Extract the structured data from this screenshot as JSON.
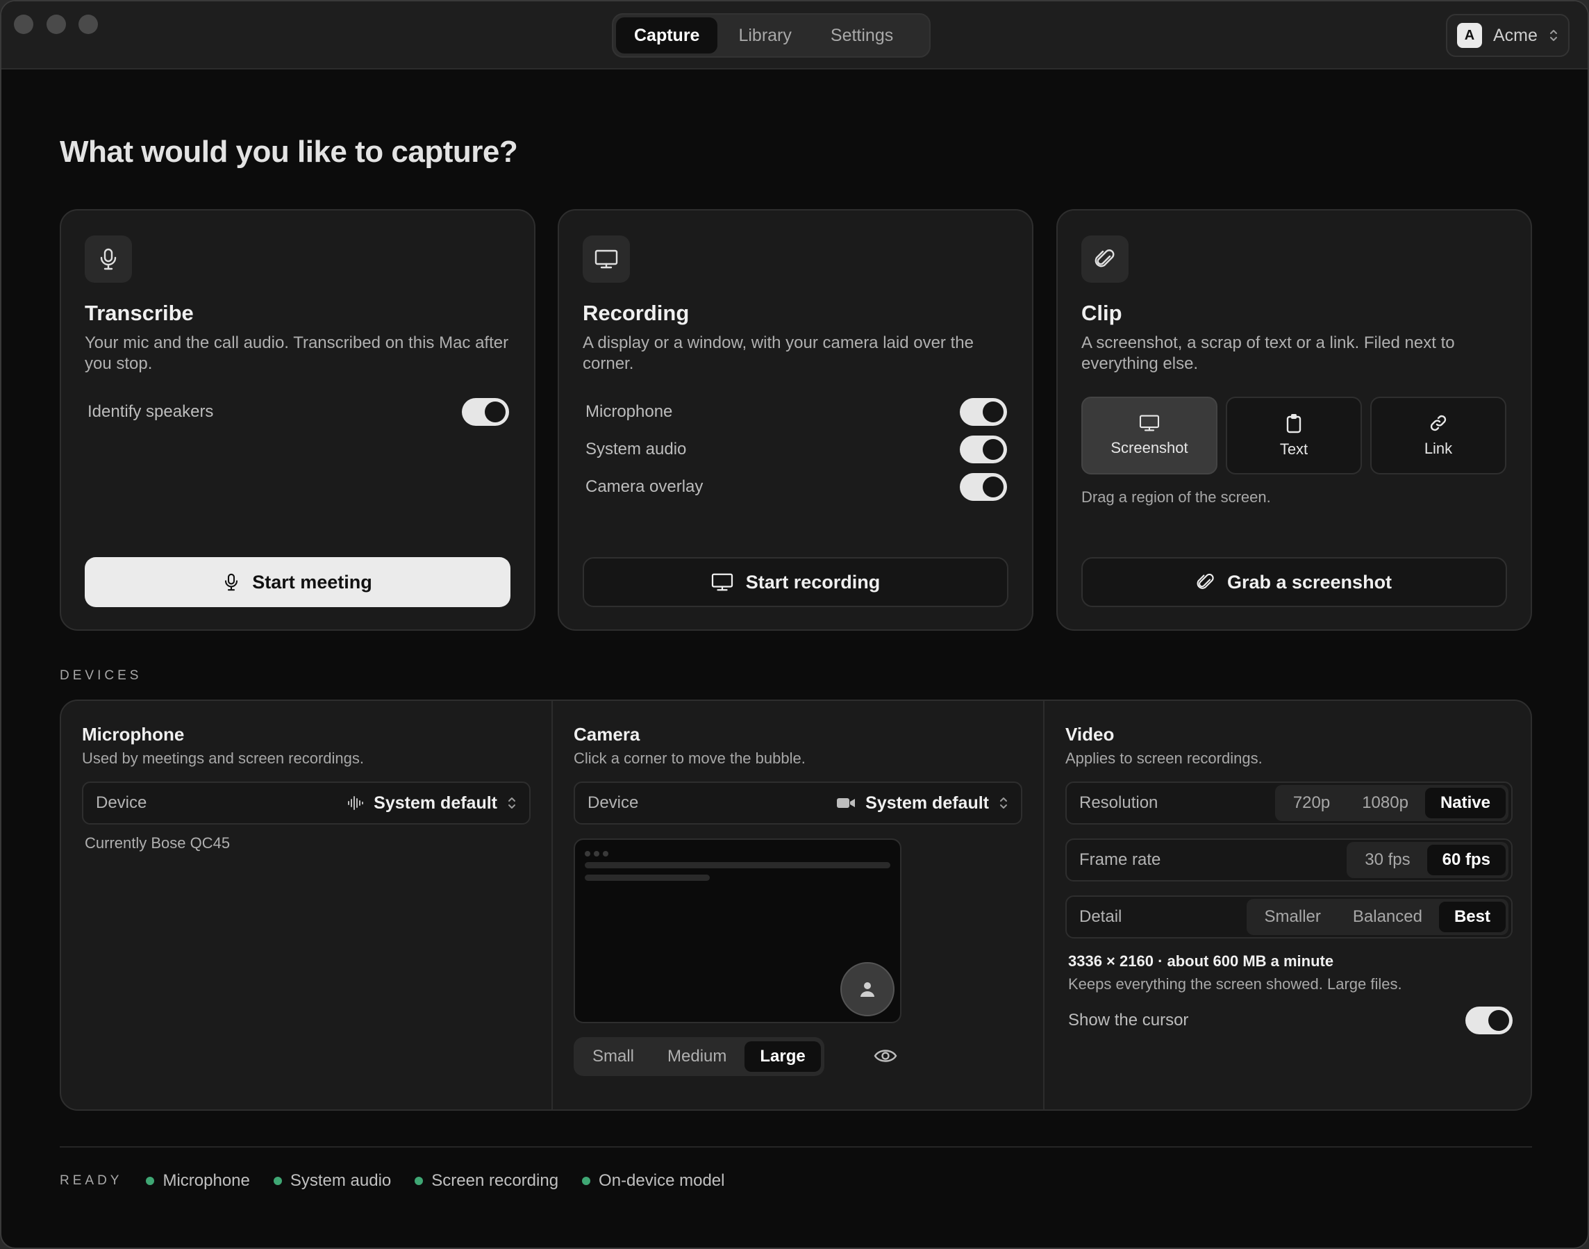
{
  "header": {
    "tabs": [
      {
        "label": "Capture",
        "active": true
      },
      {
        "label": "Library",
        "active": false
      },
      {
        "label": "Settings",
        "active": false
      }
    ],
    "account": {
      "initial": "A",
      "name": "Acme"
    }
  },
  "page_title": "What would you like to capture?",
  "cards": {
    "transcribe": {
      "icon": "microphone-icon",
      "title": "Transcribe",
      "description": "Your mic and the call audio. Transcribed on this Mac after you stop.",
      "options": [
        {
          "label": "Identify speakers",
          "on": true
        }
      ],
      "action": "Start meeting"
    },
    "recording": {
      "icon": "display-icon",
      "title": "Recording",
      "description": "A display or a window, with your camera laid over the corner.",
      "options": [
        {
          "label": "Microphone",
          "on": true
        },
        {
          "label": "System audio",
          "on": true
        },
        {
          "label": "Camera overlay",
          "on": true
        }
      ],
      "action": "Start recording"
    },
    "clip": {
      "icon": "paperclip-icon",
      "title": "Clip",
      "description": "A screenshot, a scrap of text or a link. Filed next to everything else.",
      "modes": [
        {
          "label": "Screenshot",
          "icon": "display-icon",
          "active": true
        },
        {
          "label": "Text",
          "icon": "clipboard-icon",
          "active": false
        },
        {
          "label": "Link",
          "icon": "link-icon",
          "active": false
        }
      ],
      "hint": "Drag a region of the screen.",
      "action": "Grab a screenshot"
    }
  },
  "devices": {
    "section_label": "DEVICES",
    "microphone": {
      "title": "Microphone",
      "subtitle": "Used by meetings and screen recordings.",
      "field_label": "Device",
      "field_value": "System default",
      "note": "Currently Bose QC45"
    },
    "camera": {
      "title": "Camera",
      "subtitle": "Click a corner to move the bubble.",
      "field_label": "Device",
      "field_value": "System default",
      "sizes": [
        {
          "label": "Small",
          "active": false
        },
        {
          "label": "Medium",
          "active": false
        },
        {
          "label": "Large",
          "active": true
        }
      ]
    },
    "video": {
      "title": "Video",
      "subtitle": "Applies to screen recordings.",
      "rows": [
        {
          "label": "Resolution",
          "options": [
            "720p",
            "1080p",
            "Native"
          ],
          "selected": 2
        },
        {
          "label": "Frame rate",
          "options": [
            "30 fps",
            "60 fps"
          ],
          "selected": 1
        },
        {
          "label": "Detail",
          "options": [
            "Smaller",
            "Balanced",
            "Best"
          ],
          "selected": 2
        }
      ],
      "info": "3336 × 2160 · about 600 MB a minute",
      "info_detail": "Keeps everything the screen showed. Large files.",
      "cursor_label": "Show the cursor",
      "cursor_on": true
    }
  },
  "footer": {
    "label": "READY",
    "status_color": "#3fa774",
    "items": [
      "Microphone",
      "System audio",
      "Screen recording",
      "On-device model"
    ]
  }
}
